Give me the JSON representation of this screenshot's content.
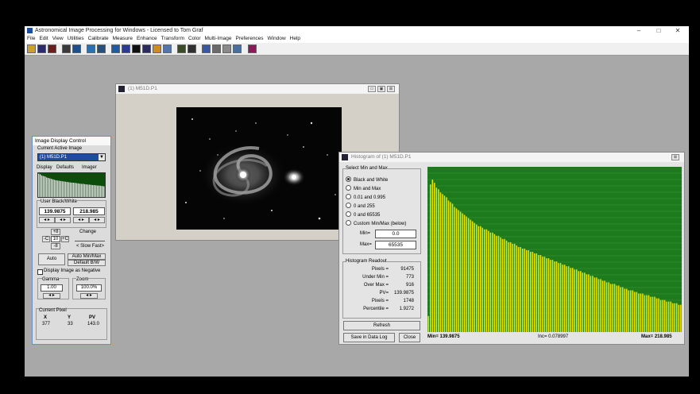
{
  "app": {
    "title": "Astronomical Image Processing for Windows - Licensed to Tom Graf",
    "menu": [
      "File",
      "Edit",
      "View",
      "Utilities",
      "Calibrate",
      "Measure",
      "Enhance",
      "Transform",
      "Color",
      "Multi-Image",
      "Preferences",
      "Window",
      "Help"
    ],
    "window_controls": {
      "minimize": "–",
      "maximize": "□",
      "close": "✕"
    }
  },
  "image_window": {
    "title": "(1) M51D.P1",
    "buttons": {
      "minimize": "▭",
      "maximize": "▣",
      "close": "⊠"
    }
  },
  "idc": {
    "title": "Image Display Control",
    "current_active_label": "Current Active Image",
    "current_active_value": "(1) M51D.P1",
    "tabs": [
      "Display",
      "Defaults",
      "Imager"
    ],
    "user_bw_label": "User Black/White",
    "black_value": "139.9875",
    "white_value": "218.985",
    "plus8": "+8",
    "minus8": "-8",
    "minusC": "-C",
    "plusC": "+C",
    "step_value": "10",
    "change_label": "Change",
    "slow_fast": "< Slow Fast>",
    "auto_label": "Auto",
    "auto_minmax_label": "Auto Min/Max",
    "default_bw_label": "Default B/W",
    "negative_label": "Display Image as Negative",
    "gamma_label": "Gamma",
    "gamma_value": "1.00",
    "zoom_label": "Zoom",
    "zoom_value": "100.0%",
    "current_pixel_label": "Current Pixel",
    "px_headers": [
      "X",
      "Y",
      "PV"
    ],
    "px_values": [
      "377",
      "33",
      "143.0"
    ],
    "mini_histogram_levels": [
      0.98,
      0.95,
      0.9,
      0.88,
      0.86,
      0.82,
      0.8,
      0.78,
      0.76,
      0.74,
      0.72,
      0.7,
      0.69,
      0.68,
      0.67,
      0.66,
      0.65,
      0.64,
      0.63,
      0.62,
      0.61,
      0.6,
      0.6,
      0.59,
      0.58,
      0.57,
      0.56,
      0.55,
      0.55,
      0.54,
      0.53,
      0.52,
      0.52,
      0.51,
      0.5,
      0.5,
      0.49,
      0.48,
      0.48,
      0.47,
      0.46,
      0.45
    ]
  },
  "histogram": {
    "title": "Histogram of (1) M51D.P1",
    "close": "⊠",
    "select_label": "Select Min and Max",
    "options": [
      "Black and White",
      "Min and Max",
      "0.01 and 0.995",
      "0 and 255",
      "0 and 65535",
      "Custom Min/Max (below)"
    ],
    "selected_option": 0,
    "min_label": "Min=",
    "min_value": "0.0",
    "max_label": "Max=",
    "max_value": "65535",
    "readout_label": "Histogram Readout",
    "readout": [
      {
        "label": "Pixels =",
        "value": "91475"
      },
      {
        "label": "Under Min =",
        "value": "773"
      },
      {
        "label": "Over Max =",
        "value": "916"
      },
      {
        "label": "PV=",
        "value": "139.9875"
      },
      {
        "label": "Pixels =",
        "value": "1748"
      },
      {
        "label": "Percentile =",
        "value": "1.9272"
      }
    ],
    "refresh_label": "Refresh",
    "save_label": "Save in Data Log",
    "close_label": "Close",
    "min_axis": "Min= 139.9875",
    "inc_axis": "Inc= 0.078997",
    "max_axis": "Max= 218.985",
    "bg_color": "#1d7a1d",
    "bar_color": "#e6e600"
  },
  "chart_data": {
    "type": "bar",
    "title": "",
    "xlabel": "",
    "ylabel": "",
    "x_range": [
      139.9875,
      218.985
    ],
    "bin_width": 0.078997,
    "relative_counts": [
      0.1,
      0.92,
      0.95,
      0.93,
      0.9,
      0.89,
      0.87,
      0.86,
      0.85,
      0.84,
      0.82,
      0.81,
      0.8,
      0.78,
      0.77,
      0.76,
      0.75,
      0.74,
      0.73,
      0.72,
      0.71,
      0.7,
      0.69,
      0.68,
      0.67,
      0.66,
      0.66,
      0.65,
      0.64,
      0.64,
      0.63,
      0.62,
      0.62,
      0.61,
      0.6,
      0.6,
      0.59,
      0.58,
      0.58,
      0.57,
      0.56,
      0.56,
      0.55,
      0.55,
      0.54,
      0.53,
      0.53,
      0.52,
      0.52,
      0.51,
      0.51,
      0.5,
      0.5,
      0.49,
      0.49,
      0.48,
      0.48,
      0.47,
      0.47,
      0.46,
      0.46,
      0.45,
      0.45,
      0.44,
      0.44,
      0.43,
      0.43,
      0.42,
      0.42,
      0.41,
      0.41,
      0.4,
      0.4,
      0.39,
      0.39,
      0.38,
      0.38,
      0.37,
      0.37,
      0.36,
      0.36,
      0.35,
      0.35,
      0.34,
      0.34,
      0.33,
      0.33,
      0.32,
      0.32,
      0.31,
      0.31,
      0.3,
      0.3,
      0.3,
      0.29,
      0.29,
      0.28,
      0.28,
      0.27,
      0.27,
      0.26,
      0.26,
      0.26,
      0.25,
      0.25,
      0.24,
      0.24,
      0.24,
      0.23,
      0.23,
      0.23,
      0.22,
      0.22,
      0.22,
      0.21,
      0.21,
      0.2,
      0.2,
      0.2,
      0.19,
      0.19,
      0.19,
      0.18,
      0.18,
      0.18,
      0.17,
      0.17
    ]
  }
}
